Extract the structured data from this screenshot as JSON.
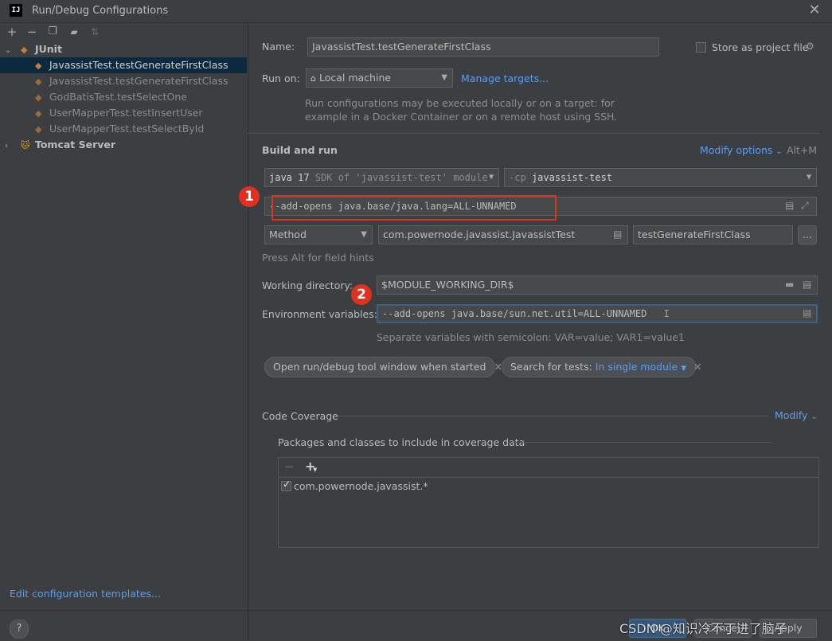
{
  "window": {
    "title": "Run/Debug Configurations",
    "logo": "IJ"
  },
  "left_toolbar": [
    "plus-icon",
    "minus-icon",
    "copy-icon",
    "folder-add-icon",
    "sort-icon"
  ],
  "tree": {
    "junit_group": "JUnit",
    "junit_items": [
      "JavassistTest.testGenerateFirstClass",
      "JavassistTest.testGenerateFirstClass",
      "GodBatisTest.testSelectOne",
      "UserMapperTest.testInsertUser",
      "UserMapperTest.testSelectById"
    ],
    "tomcat_group": "Tomcat Server"
  },
  "edit_templates": "Edit configuration templates...",
  "form": {
    "name_label": "Name:",
    "name_value": "JavassistTest.testGenerateFirstClass",
    "store_label": "Store as project file",
    "run_on_label": "Run on:",
    "run_on_value": "Local machine",
    "manage_targets": "Manage targets...",
    "run_on_hint_1": "Run configurations may be executed locally or on a target: for",
    "run_on_hint_2": "example in a Docker Container or on a remote host using SSH.",
    "build_run": "Build and run",
    "modify_options": "Modify options",
    "modify_shortcut": "Alt+M",
    "sdk_main": "java 17",
    "sdk_hint": "SDK of 'javassist-test' module",
    "cp_prefix": "-cp",
    "cp_value": "javassist-test",
    "vm_options": "--add-opens java.base/java.lang=ALL-UNNAMED",
    "method_kind": "Method",
    "class_value": "com.powernode.javassist.JavassistTest",
    "method_value": "testGenerateFirstClass",
    "more_btn": "...",
    "field_hints": "Press Alt for field hints",
    "wd_label": "Working directory:",
    "wd_value": "$MODULE_WORKING_DIR$",
    "env_label": "Environment variables:",
    "env_value": "--add-opens java.base/sun.net.util=ALL-UNNAMED",
    "env_hint": "Separate variables with semicolon: VAR=value; VAR1=value1",
    "chip1": "Open run/debug tool window when started",
    "chip2_prefix": "Search for tests:",
    "chip2_value": "In single module",
    "coverage": "Code Coverage",
    "modify": "Modify",
    "packages_label": "Packages and classes to include in coverage data",
    "package_item": "com.powernode.javassist.*"
  },
  "badges": {
    "one": "1",
    "two": "2"
  },
  "buttons": {
    "ok": "OK",
    "cancel": "Cancel",
    "apply": "Apply"
  },
  "watermark": "CSDN @知识冷不丁进了脑子",
  "colors": {
    "accent": "#589df6",
    "selection": "#0d293e",
    "annotation": "#e0321f"
  }
}
